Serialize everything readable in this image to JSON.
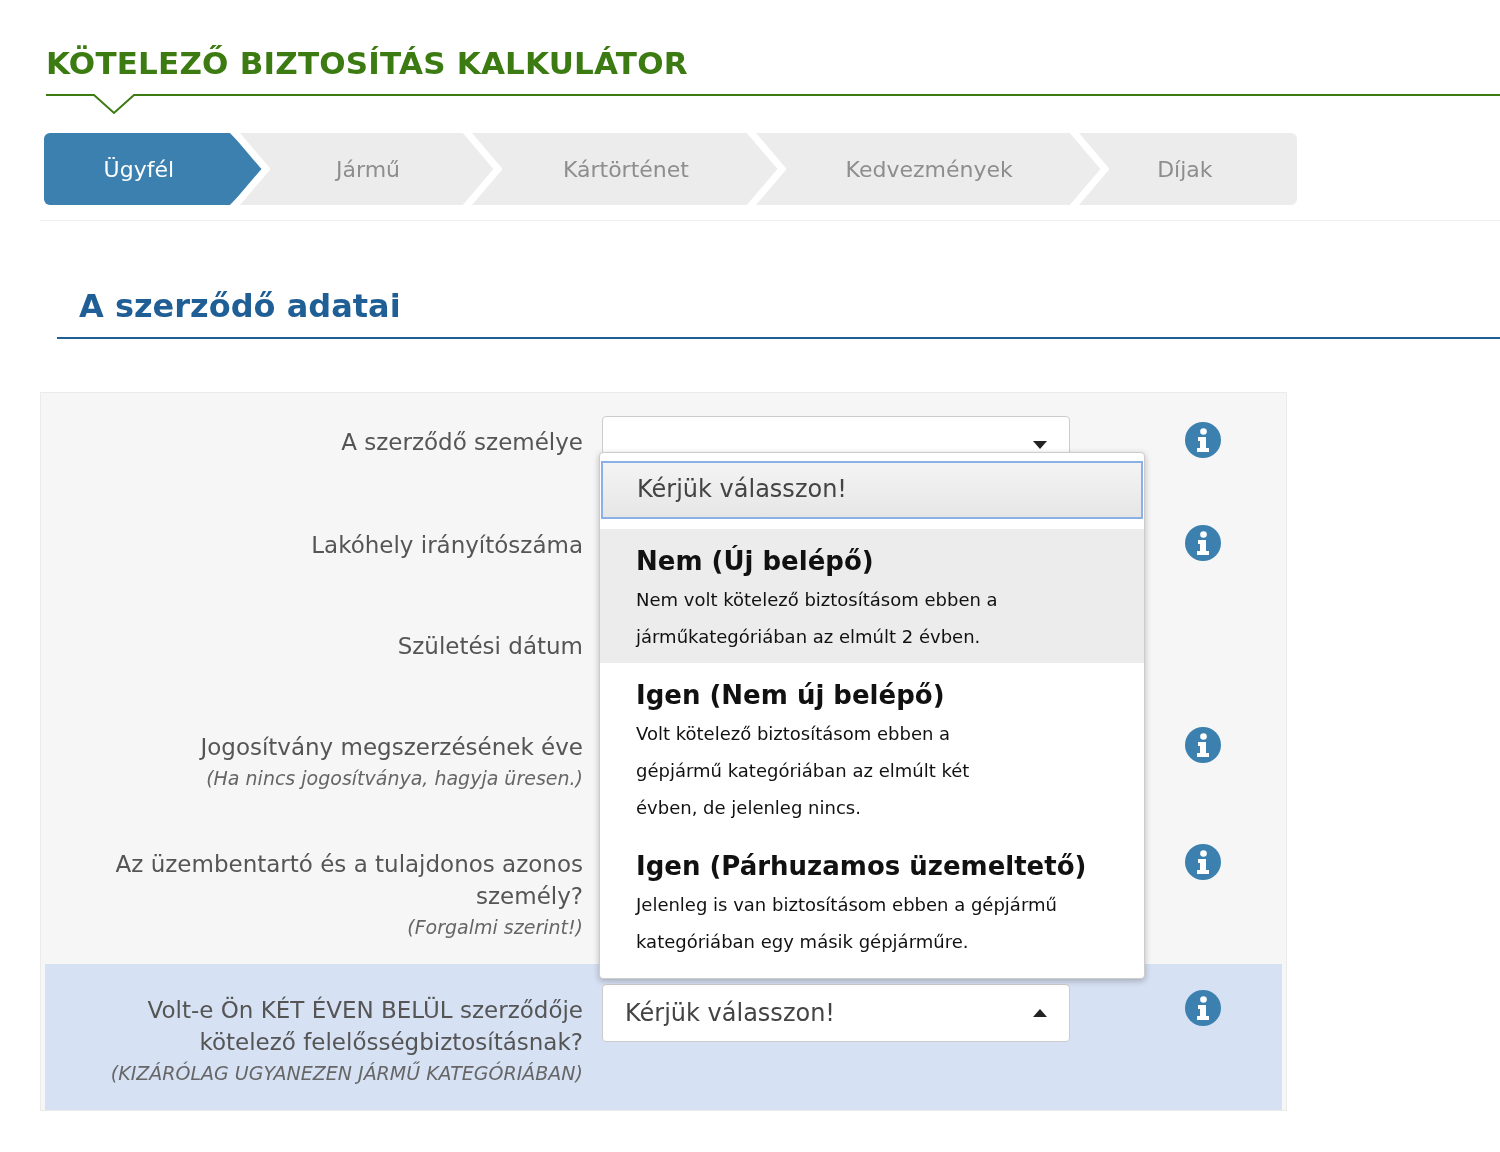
{
  "title": "KÖTELEZŐ BIZTOSÍTÁS KALKULÁTOR",
  "steps": [
    {
      "label": "Ügyfél",
      "selected": true
    },
    {
      "label": "Jármű",
      "selected": false
    },
    {
      "label": "Kártörténet",
      "selected": false
    },
    {
      "label": "Kedvezmények",
      "selected": false
    },
    {
      "label": "Díjak",
      "selected": false
    }
  ],
  "section_title": "A szerződő adatai",
  "rows": [
    {
      "label": "A szerződő személye",
      "kind": "select",
      "open": false,
      "info": true,
      "highlighted": false
    },
    {
      "label": "Lakóhely irányítószáma",
      "info": true,
      "highlighted": false
    },
    {
      "label": "Születési dátum",
      "info": false,
      "highlighted": false
    },
    {
      "label": "Jogosítvány megszerzésének éve",
      "note": "(Ha nincs jogosítványa, hagyja üresen.)",
      "info": true,
      "highlighted": false
    },
    {
      "label": "Az üzembentartó és a tulajdonos azonos személy?",
      "note": "(Forgalmi szerint!)",
      "info": true,
      "highlighted": false
    },
    {
      "label": "Volt-e Ön KÉT ÉVEN BELÜL szerződője kötelező felelősségbiztosításnak?",
      "note": "(KIZÁRÓLAG UGYANEZEN JÁRMŰ KATEGÓRIÁBAN)",
      "kind": "select",
      "value": "Kérjük válasszon!",
      "open": true,
      "info": true,
      "highlighted": true
    }
  ],
  "dropdown": {
    "options": [
      {
        "title": "Kérjük válasszon!",
        "selected": true,
        "hovered": false
      },
      {
        "title": "Nem (Új belépő)",
        "description": "Nem volt kötelező biztosításom ebben a járműkategóriában az elmúlt 2 évben.",
        "selected": false,
        "hovered": true
      },
      {
        "title": "Igen (Nem új belépő)",
        "description": "Volt kötelező biztosításom ebben a gépjármű kategóriában az elmúlt két évben, de jelenleg nincs.",
        "selected": false,
        "hovered": false
      },
      {
        "title": "Igen (Párhuzamos üzemeltető)",
        "description": "Jelenleg is van biztosításom ebben a gépjármű kategóriában egy másik gépjárműre.",
        "selected": false,
        "hovered": false
      }
    ]
  }
}
